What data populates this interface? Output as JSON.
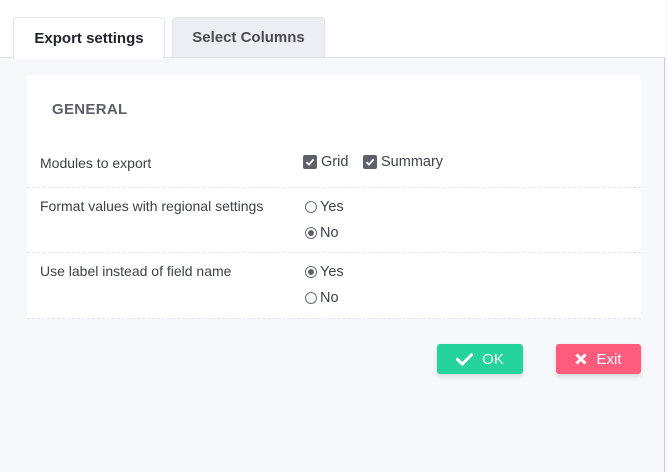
{
  "tabs": [
    {
      "label": "Export settings",
      "active": true
    },
    {
      "label": "Select Columns",
      "active": false
    }
  ],
  "section_title": "GENERAL",
  "rows": [
    {
      "label": "Modules to export",
      "options": [
        {
          "label": "Grid",
          "type": "checkbox",
          "checked": true
        },
        {
          "label": "Summary",
          "type": "checkbox",
          "checked": true
        }
      ]
    },
    {
      "label": "Format values with regional settings",
      "options": [
        {
          "label": "Yes",
          "type": "radio",
          "checked": false
        },
        {
          "label": "No",
          "type": "radio",
          "checked": true
        }
      ]
    },
    {
      "label": "Use label instead of field name",
      "options": [
        {
          "label": "Yes",
          "type": "radio",
          "checked": true
        },
        {
          "label": "No",
          "type": "radio",
          "checked": false
        }
      ]
    }
  ],
  "buttons": {
    "ok_label": "OK",
    "exit_label": "Exit"
  },
  "colors": {
    "ok": "#25d39c",
    "exit": "#fd5c7c",
    "checkbox": "#5e6169"
  },
  "icons": {
    "ok": "checkmark-icon",
    "exit": "x-icon"
  }
}
